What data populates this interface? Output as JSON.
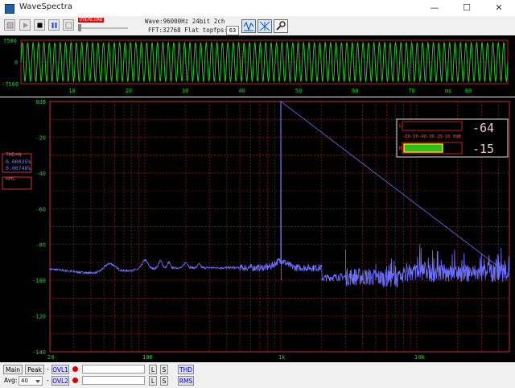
{
  "window": {
    "title": "WaveSpectra",
    "min_glyph": "—",
    "max_glyph": "☐",
    "close_glyph": "✕"
  },
  "toolbar": {
    "ovl_indicator": "OVERLOAD",
    "wave_info": "Wave:96000Hz 24bit 2ch",
    "fft_info": "FFT:32768 Flat top",
    "fps_label": "fps:",
    "fps_value": "63"
  },
  "wave": {
    "ylabels": [
      "7500",
      "0",
      "-7500"
    ],
    "xticks": [
      "10",
      "20",
      "30",
      "40",
      "50",
      "60",
      "70",
      "80"
    ],
    "unit": "ms",
    "cycles": 90,
    "trace_color": "#1fc91f"
  },
  "spectrum": {
    "ylabels": [
      "0dB",
      "-20",
      "-40",
      "-60",
      "-80",
      "-100",
      "-120",
      "-140"
    ],
    "xlabels": [
      "20",
      "100",
      "1k",
      "10k"
    ],
    "trace_color": "#6f6fff",
    "grid_color": "#8a1f1f"
  },
  "thd_box": {
    "label": "THD+N",
    "values": [
      "0.00035%",
      "0.00748%"
    ]
  },
  "rms_box": {
    "label": "RMS"
  },
  "meter": {
    "l_label": "L",
    "r_label": "R",
    "scale": "-60-50-40-30-20-10 0dB",
    "l_value": "-64",
    "r_value": "-15",
    "bar_color": "#2bbd1f"
  },
  "statusbar": {
    "main": "Main",
    "peak": "Peak",
    "dash": "-",
    "ovl1": "OVL1",
    "avg_label": "Avg:",
    "avg_value": "40",
    "ovl2": "OVL2",
    "l": "L",
    "s": "S",
    "thd": "THD",
    "rms": "RMS"
  }
}
